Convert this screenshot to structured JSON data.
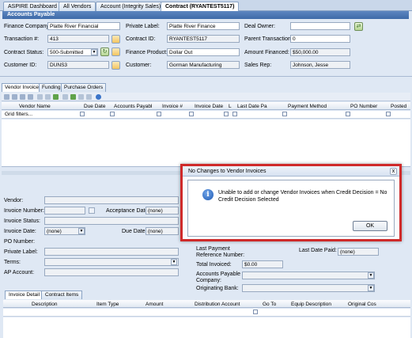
{
  "tabs": [
    {
      "label": "ASPIRE Dashboard"
    },
    {
      "label": "All Vendors"
    },
    {
      "label": "Account (Integrity Sales)"
    },
    {
      "label": "Contract (RYANTEST5117)"
    }
  ],
  "header": {
    "title": "Accounts Payable"
  },
  "form": {
    "finance_company": {
      "label": "Finance Company:",
      "value": "Platte River Financial"
    },
    "transaction_num": {
      "label": "Transaction #:",
      "value": "413"
    },
    "contract_status": {
      "label": "Contract Status:",
      "value": "500-Submitted"
    },
    "customer_id": {
      "label": "Customer ID:",
      "value": "DUNS3"
    },
    "private_label": {
      "label": "Private Label:",
      "value": "Platte River Finance"
    },
    "contract_id": {
      "label": "Contract ID:",
      "value": "RYANTEST5117"
    },
    "finance_product": {
      "label": "Finance Product:",
      "value": "Dollar Out"
    },
    "customer": {
      "label": "Customer:",
      "value": "Gorman Manufacturing"
    },
    "deal_owner": {
      "label": "Deal Owner:",
      "value": ""
    },
    "parent_transaction": {
      "label": "Parent Transaction:",
      "value": "0"
    },
    "amount_financed": {
      "label": "Amount Financed:",
      "value": "$50,000.00"
    },
    "sales_rep": {
      "label": "Sales Rep:",
      "value": "Johnson, Jesse"
    }
  },
  "subtabs": [
    {
      "label": "Vendor Invoice"
    },
    {
      "label": "Funding"
    },
    {
      "label": "Purchase Orders"
    }
  ],
  "grid": {
    "columns": [
      "Vendor Name",
      "Due Date",
      "Accounts Payabl",
      "Invoice #",
      "Invoice Date",
      "L",
      "Last Date Pa",
      "Payment Method",
      "PO Number",
      "Posted"
    ],
    "filter_placeholder": "Grid filters..."
  },
  "detail": {
    "vendor": "Vendor:",
    "invoice_number": "Invoice Number:",
    "acceptance_date": {
      "label": "Acceptance Date:",
      "value": "(none)"
    },
    "invoice_status": "Invoice Status:",
    "invoice_date": {
      "label": "Invoice Date:",
      "value": "(none)"
    },
    "due_date": {
      "label": "Due Date:",
      "value": "(none)"
    },
    "po_number": "PO Number:",
    "private_label": "Private Label:",
    "terms": "Terms:",
    "ap_account": "AP Account:",
    "last_payment": "Last Payment",
    "reference_number": "Reference Number:",
    "last_date_paid": {
      "label": "Last Date Paid:",
      "value": "(none)"
    },
    "total_invoiced": {
      "label": "Total Invoiced:",
      "value": "$0.00"
    },
    "ap_company": "Accounts Payable Company:",
    "originating_bank": "Originating Bank:"
  },
  "dialog": {
    "title": "No Changes to Vendor Invoices",
    "message": "Unable to add or change Vendor Invoices when Credit Decision = No Credit Decision Selected",
    "ok_label": "OK",
    "close_glyph": "x"
  },
  "bottom_tabs": [
    {
      "label": "Invoice Detail"
    },
    {
      "label": "Contract Items"
    }
  ],
  "bottom_grid": {
    "columns": [
      "Description",
      "Item Type",
      "Amount",
      "Distribution Account",
      "Go To",
      "Equip Description",
      "Original Cos"
    ]
  },
  "colors": {
    "accent": "#3e6aa8",
    "alert_border": "#cf2a2a"
  }
}
